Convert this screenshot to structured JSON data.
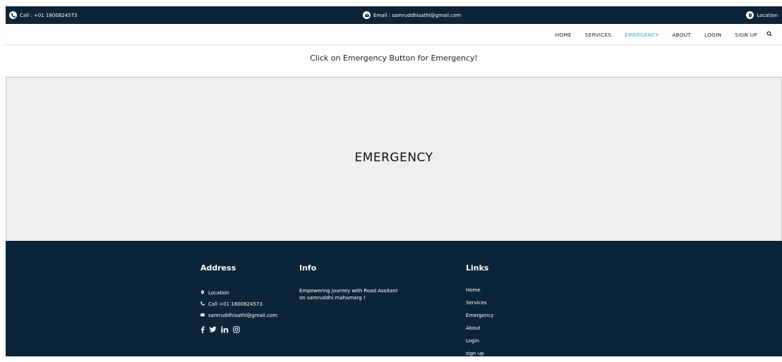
{
  "topbar": {
    "call": "Call : +01 1800824573",
    "email": "Email : samruddhisathi@gmail.com",
    "location": "Location"
  },
  "nav": {
    "items": [
      "HOME",
      "SERVICES",
      "EMERGENCY",
      "ABOUT",
      "LOGIN",
      "SIGN UP"
    ],
    "active": "EMERGENCY",
    "search_icon": "search-icon"
  },
  "notice": "Click on Emergency Button for Emergency!",
  "emergency_button": "EMERGENCY",
  "footer": {
    "address": {
      "title": "Address",
      "location": "Location",
      "call": "Call +01 1800824573",
      "email": "samruddhisathi@gmail.com"
    },
    "social_icons": [
      "facebook-icon",
      "twitter-icon",
      "linkedin-icon",
      "instagram-icon"
    ],
    "info": {
      "title": "Info",
      "text": "Empowering journey with Road Assitant on samruddhi mahamarg !"
    },
    "links": {
      "title": "Links",
      "items": [
        "Home",
        "Services",
        "Emergency",
        "About",
        "Login",
        "sign up"
      ]
    }
  },
  "colors": {
    "dark_navy": "#0b2438",
    "active_nav": "#4aa3cf",
    "panel_bg": "#efefef"
  }
}
